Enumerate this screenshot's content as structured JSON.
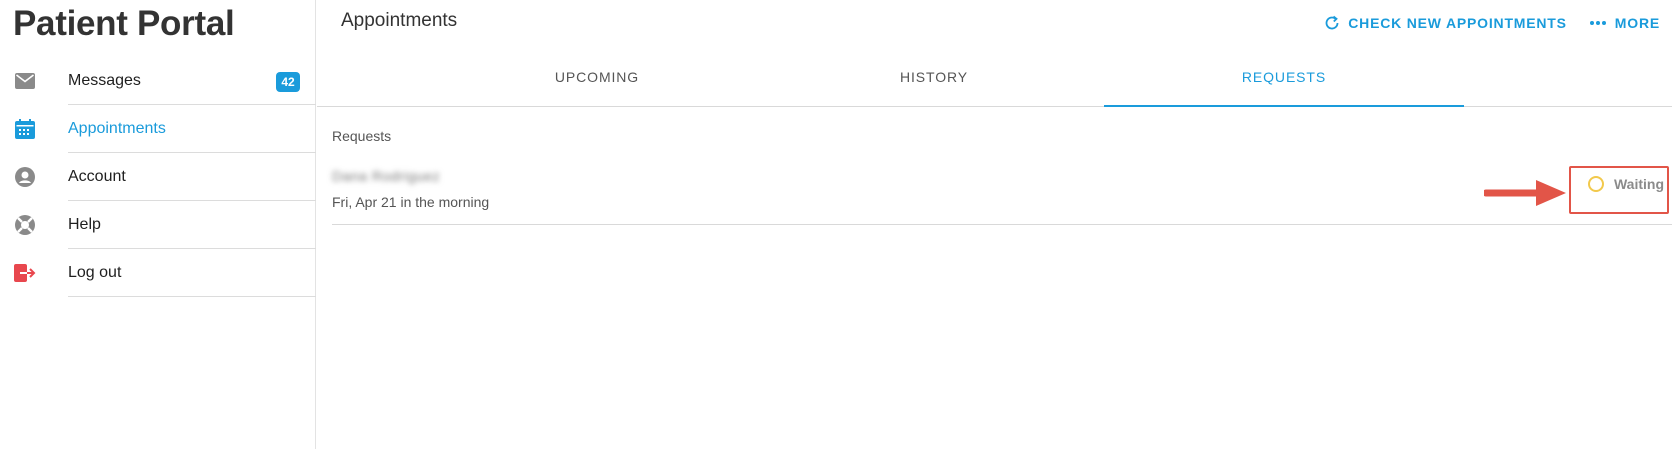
{
  "app": {
    "title": "Patient Portal"
  },
  "sidebar": {
    "items": [
      {
        "label": "Messages",
        "icon": "envelope-icon",
        "badge": "42",
        "active": false
      },
      {
        "label": "Appointments",
        "icon": "calendar-icon",
        "active": true
      },
      {
        "label": "Account",
        "icon": "user-circle-icon",
        "active": false
      },
      {
        "label": "Help",
        "icon": "lifebuoy-icon",
        "active": false
      },
      {
        "label": "Log out",
        "icon": "logout-icon",
        "active": false
      }
    ]
  },
  "header": {
    "title": "Appointments",
    "actions": [
      {
        "label": "CHECK NEW APPOINTMENTS",
        "icon": "refresh-icon"
      },
      {
        "label": "MORE",
        "icon": "more-dots-icon"
      }
    ]
  },
  "tabs": [
    {
      "label": "UPCOMING",
      "active": false
    },
    {
      "label": "HISTORY",
      "active": false
    },
    {
      "label": "REQUESTS",
      "active": true
    }
  ],
  "requests": {
    "section_label": "Requests",
    "items": [
      {
        "provider_name": "Dana Rodriguez",
        "time": "Fri, Apr 21 in the morning",
        "status": "Waiting"
      }
    ]
  },
  "colors": {
    "accent": "#1a9bdb",
    "status_waiting": "#f2c94c",
    "annotation": "#e25548",
    "logout_icon": "#e8474e"
  }
}
